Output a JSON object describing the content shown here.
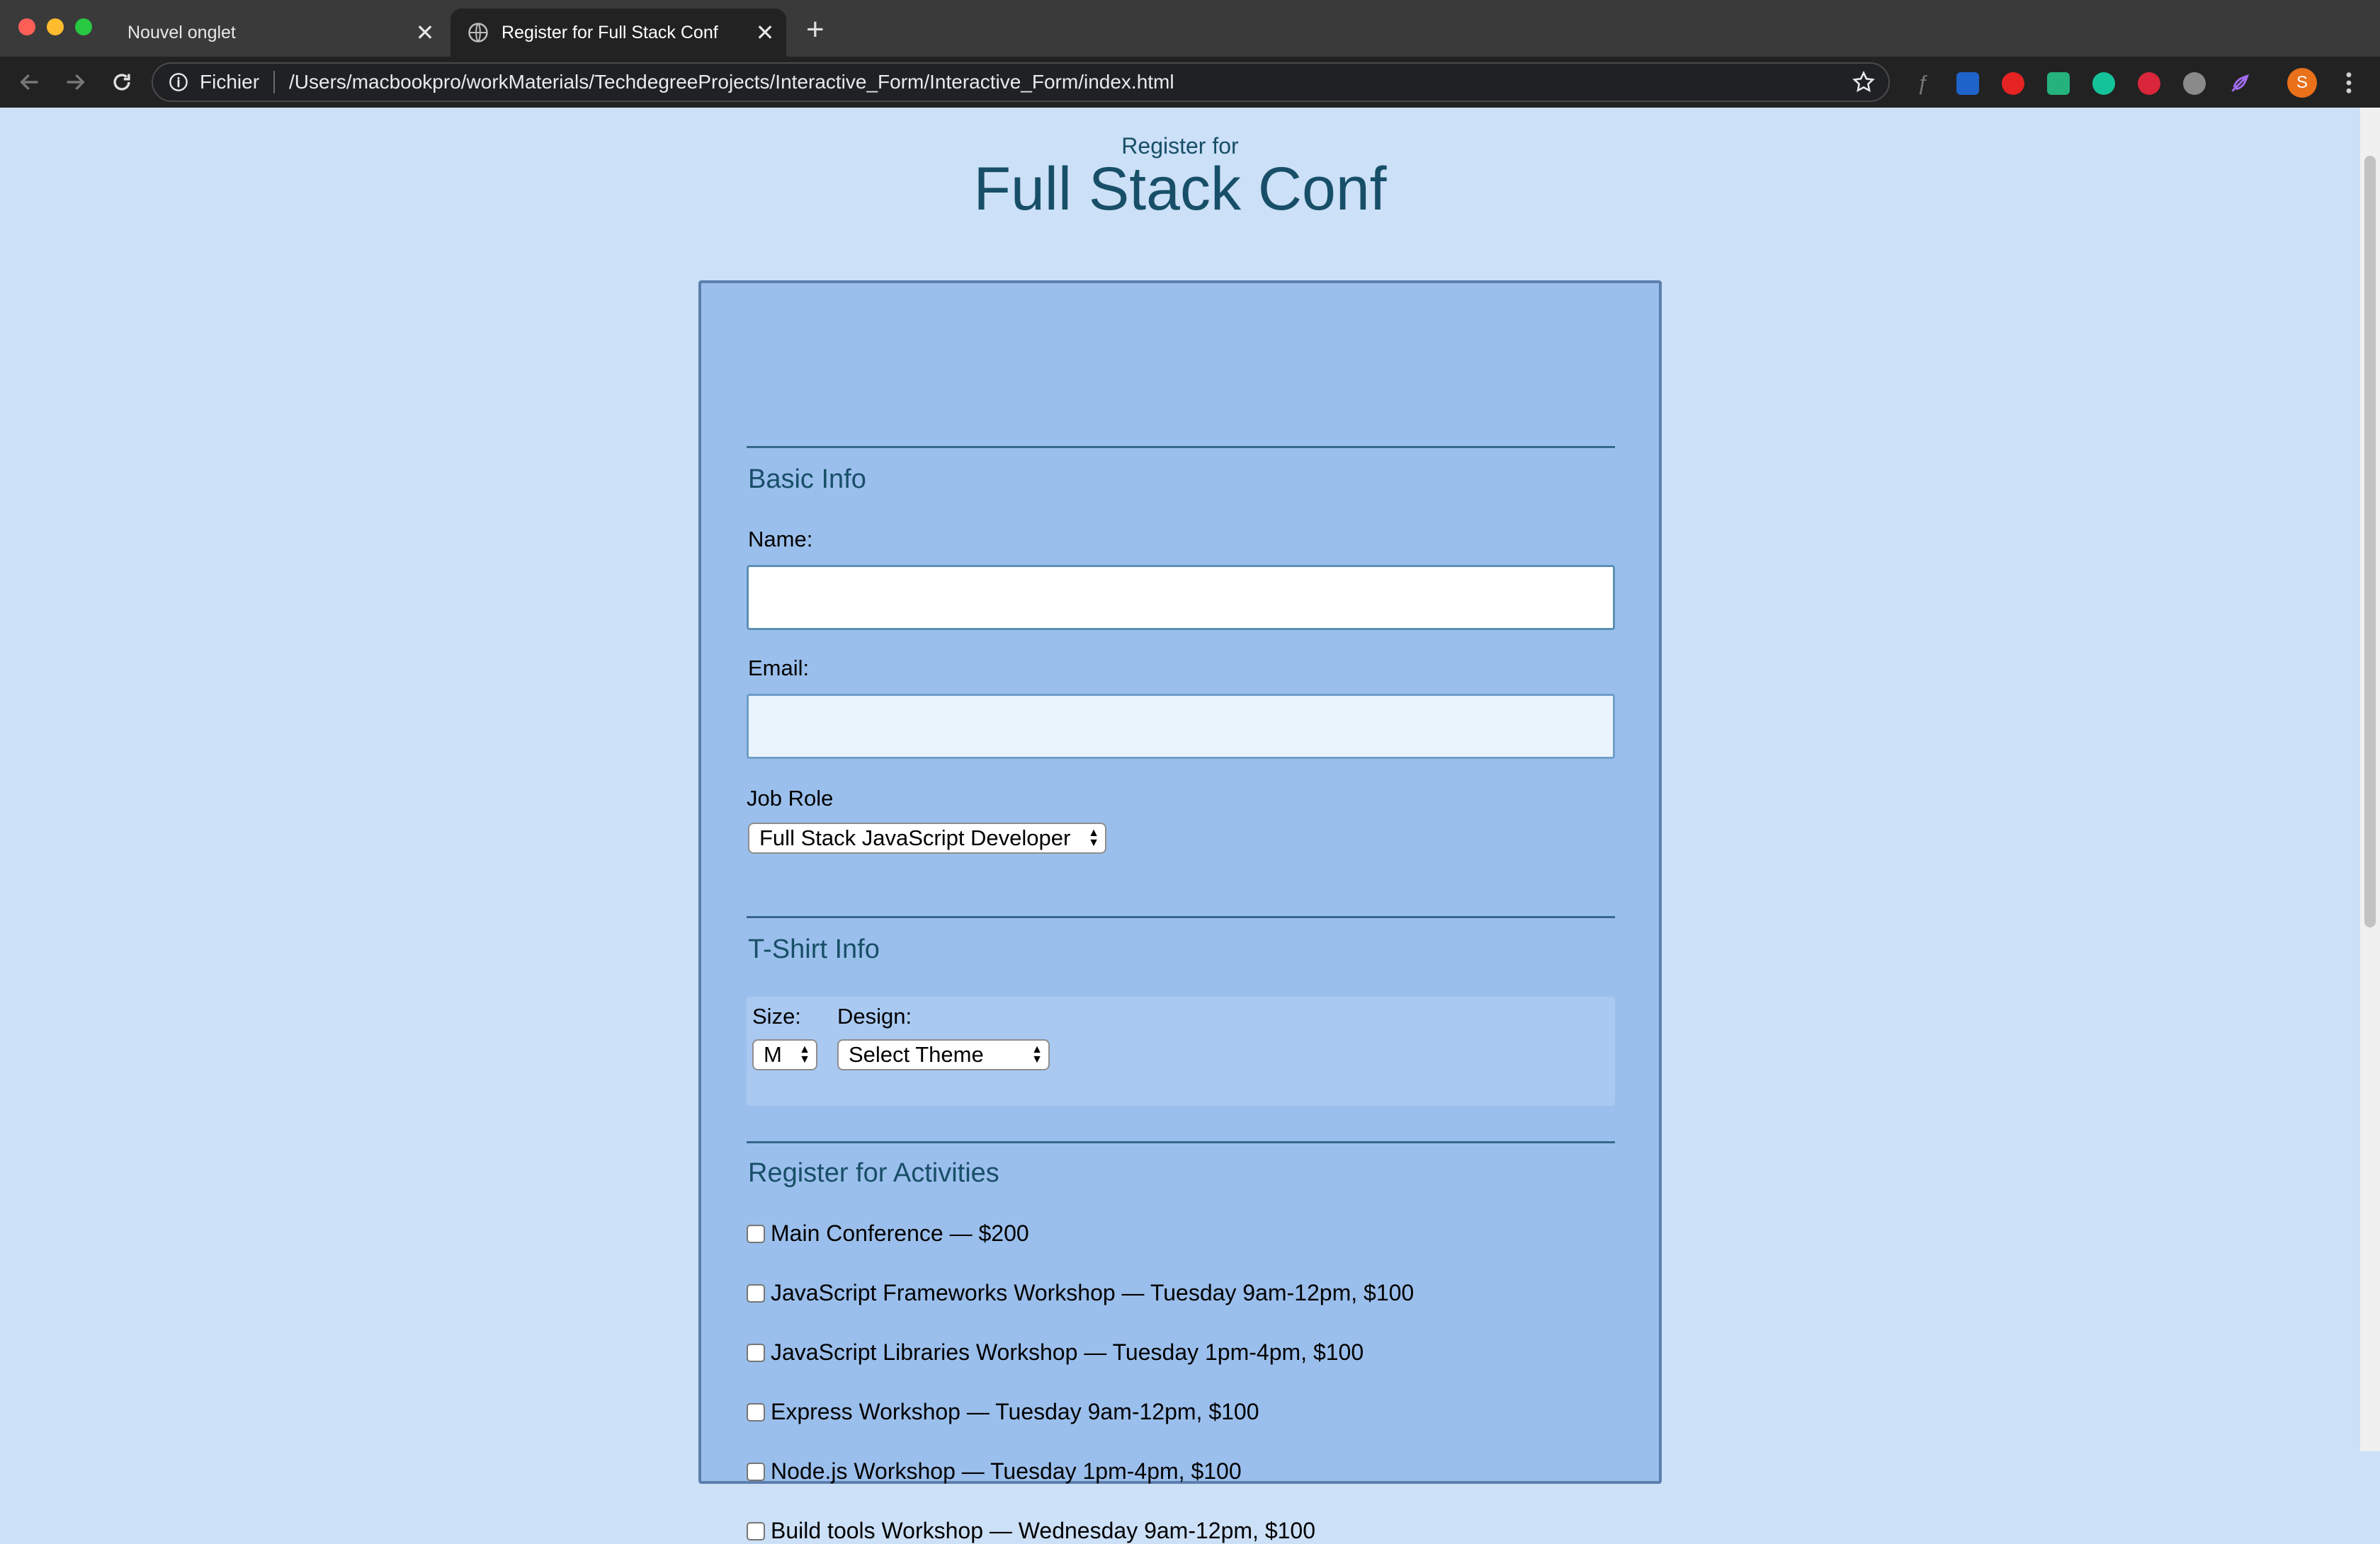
{
  "browser": {
    "tabs": [
      {
        "title": "Nouvel onglet"
      },
      {
        "title": "Register for Full Stack Conf"
      }
    ],
    "omnibox": {
      "scheme_label": "Fichier",
      "url": "/Users/macbookpro/workMaterials/TechdegreeProjects/Interactive_Form/Interactive_Form/index.html"
    },
    "profile_initial": "S"
  },
  "header": {
    "subtitle": "Register for",
    "title": "Full Stack Conf"
  },
  "basic_info": {
    "title": "Basic Info",
    "name_label": "Name:",
    "name_value": "",
    "email_label": "Email:",
    "email_value": "",
    "job_role_label": "Job Role",
    "job_role_selected": "Full Stack JavaScript Developer"
  },
  "tshirt": {
    "title": "T-Shirt Info",
    "size_label": "Size:",
    "size_selected": "M",
    "design_label": "Design:",
    "design_selected": "Select Theme"
  },
  "activities": {
    "title": "Register for Activities",
    "items": [
      {
        "label": "Main Conference — $200",
        "checked": false
      },
      {
        "label": "JavaScript Frameworks Workshop — Tuesday 9am-12pm, $100",
        "checked": false
      },
      {
        "label": "JavaScript Libraries Workshop — Tuesday 1pm-4pm, $100",
        "checked": false
      },
      {
        "label": "Express Workshop — Tuesday 9am-12pm, $100",
        "checked": false
      },
      {
        "label": "Node.js Workshop — Tuesday 1pm-4pm, $100",
        "checked": false
      },
      {
        "label": "Build tools Workshop — Wednesday 9am-12pm, $100",
        "checked": false
      }
    ]
  },
  "colors": {
    "page_background": "#cce0f7",
    "form_background": "#9bbfec",
    "heading_color": "#184f68",
    "email_field_background": "#eaf4fc"
  }
}
